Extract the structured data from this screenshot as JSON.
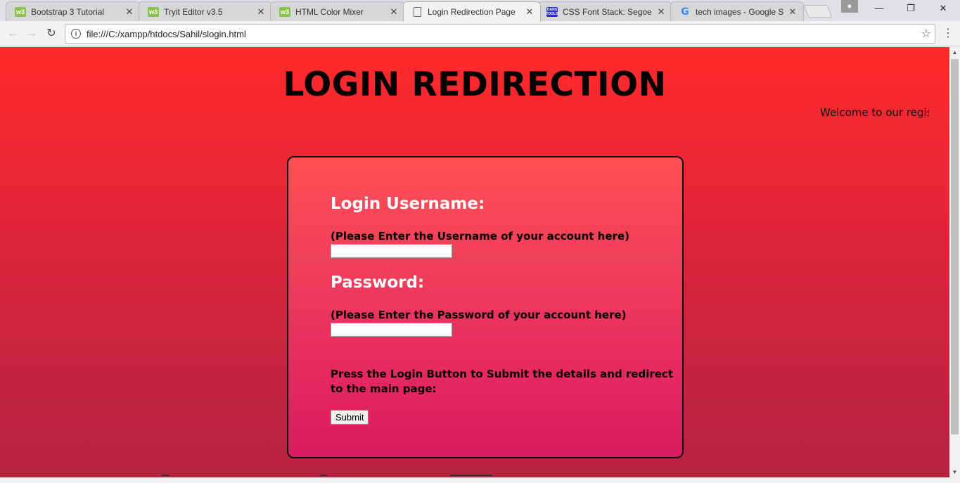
{
  "browser": {
    "tabs": [
      {
        "title": "Bootstrap 3 Tutorial",
        "favicon": "w3"
      },
      {
        "title": "Tryit Editor v3.5",
        "favicon": "w3"
      },
      {
        "title": "HTML Color Mixer",
        "favicon": "w3"
      },
      {
        "title": "Login Redirection Page",
        "favicon": "document"
      },
      {
        "title": "CSS Font Stack: Segoe U",
        "favicon": "dans"
      },
      {
        "title": "tech images - Google Se",
        "favicon": "google"
      }
    ],
    "favicon_text": {
      "w3": "w3",
      "dans": "DANS TOOLS",
      "google": "G"
    },
    "address": "file:///C:/xampp/htdocs/Sahil/slogin.html",
    "icons": {
      "close": "✕",
      "back": "←",
      "forward": "→",
      "reload": "↻",
      "info": "i",
      "star": "☆",
      "menu": "⋮",
      "minimize": "—",
      "restore": "❐",
      "window_close": "✕",
      "profile": "●",
      "scroll_up": "▲",
      "scroll_down": "▼"
    }
  },
  "page": {
    "heading": "LOGIN REDIRECTION",
    "marquee": "Welcome to our regist",
    "form": {
      "username_label": "Login Username:",
      "username_hint": "(Please Enter the Username of your account here)",
      "username_value": "",
      "password_label": "Password:",
      "password_hint": "(Please Enter the Password of your account here)",
      "password_value": "",
      "submit_hint": "Press the Login Button to Submit the details and redirect to the main page:",
      "submit_label": "Submit"
    }
  },
  "colors": {
    "page_gradient_top": "#ff2a2a",
    "page_gradient_bottom": "#b62442",
    "box_gradient_top": "#ff5055",
    "box_gradient_bottom": "#dc1a60"
  }
}
